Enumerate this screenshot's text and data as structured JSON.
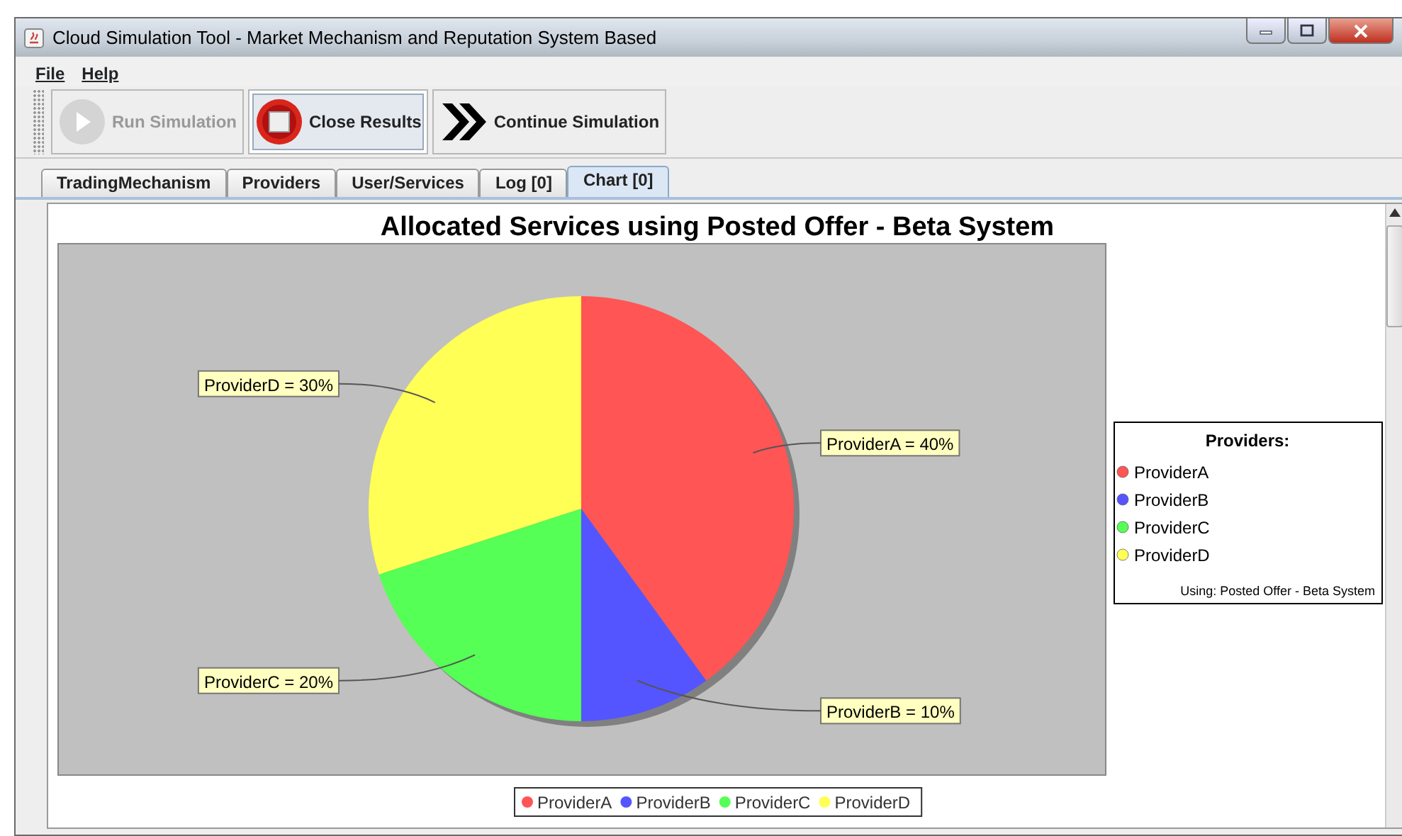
{
  "window": {
    "title": "Cloud Simulation Tool - Market Mechanism and Reputation System Based"
  },
  "menu": [
    {
      "label": "File"
    },
    {
      "label": "Help"
    }
  ],
  "toolbar": [
    {
      "label": "Run Simulation",
      "kind": "play",
      "disabled": true
    },
    {
      "label": "Close Results",
      "kind": "stop",
      "disabled": false
    },
    {
      "label": "Continue Simulation",
      "kind": "forward",
      "disabled": false
    }
  ],
  "tabs": [
    {
      "label": "TradingMechanism",
      "selected": false
    },
    {
      "label": "Providers",
      "selected": false
    },
    {
      "label": "User/Services",
      "selected": false
    },
    {
      "label": "Log [0]",
      "selected": false
    },
    {
      "label": "Chart [0]",
      "selected": true
    }
  ],
  "chart": {
    "chart_data": {
      "type": "pie",
      "title": "Allocated Services using Posted Offer - Beta System",
      "categories": [
        "ProviderA",
        "ProviderB",
        "ProviderC",
        "ProviderD"
      ],
      "values": [
        40,
        10,
        20,
        30
      ],
      "colors": [
        "#ff5555",
        "#5555ff",
        "#55ff55",
        "#ffff55"
      ],
      "value_labels": [
        "ProviderA = 40%",
        "ProviderB = 10%",
        "ProviderC = 20%",
        "ProviderD = 30%"
      ],
      "legend": [
        {
          "kind": "box",
          "title": "Providers:",
          "note": "Using: Posted Offer - Beta System"
        },
        {
          "kind": "row"
        }
      ]
    }
  }
}
